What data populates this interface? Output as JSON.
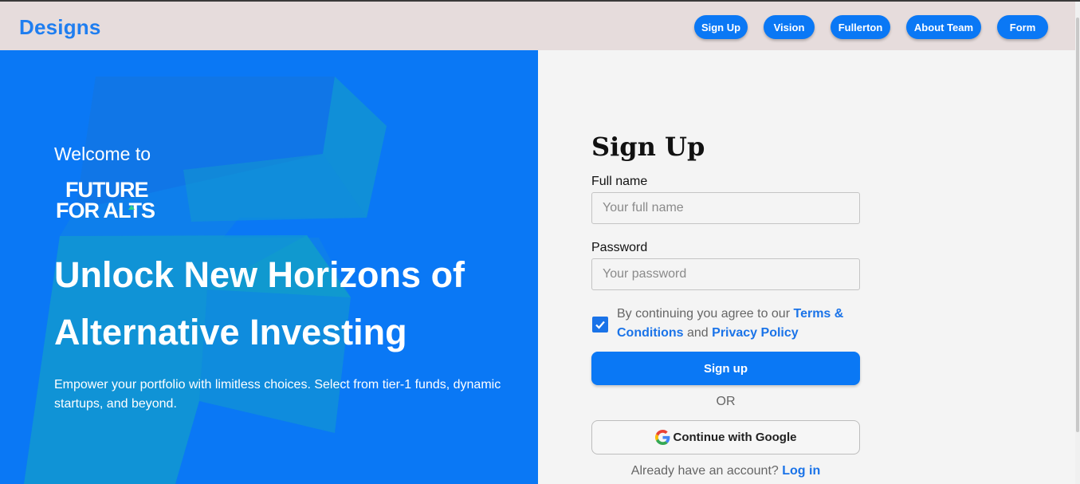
{
  "navbar": {
    "brand": "Designs",
    "items": [
      {
        "label": "Sign Up"
      },
      {
        "label": "Vision"
      },
      {
        "label": "Fullerton"
      },
      {
        "label": "About Team"
      },
      {
        "label": "Form"
      }
    ]
  },
  "hero": {
    "welcome": "Welcome to",
    "logo_text_line1": "FUTURE",
    "logo_text_line2": "FOR ALTS",
    "headline_line1": "Unlock New Horizons of",
    "headline_line2": "Alternative Investing",
    "subtext": "Empower your portfolio with limitless choices. Select from tier-1 funds, dynamic startups, and beyond."
  },
  "form": {
    "title": "Sign Up",
    "fullname_label": "Full name",
    "fullname_placeholder": "Your full name",
    "password_label": "Password",
    "password_placeholder": "Your password",
    "terms_prefix": "By continuing you agree to our ",
    "terms_link": "Terms & Conditions",
    "terms_and": " and ",
    "privacy_link": "Privacy Policy",
    "checkbox_checked": true,
    "signup_button": "Sign up",
    "or_text": "OR",
    "google_button": "Continue with Google",
    "login_prompt": "Already have an account? ",
    "login_link": "Log in"
  },
  "icons": {
    "google": "google-icon",
    "checkbox": "checkmark-icon"
  },
  "colors": {
    "primary": "#0a78f5",
    "link": "#1a73e8",
    "navbar_bg": "#e6dcdc",
    "form_bg": "#f4f4f4"
  }
}
